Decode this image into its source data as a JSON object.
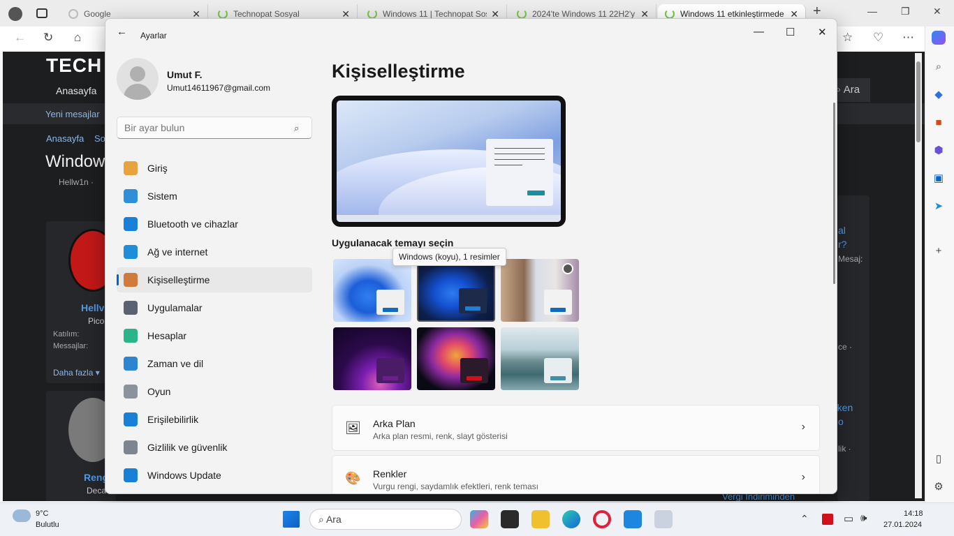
{
  "browser": {
    "tabs": [
      {
        "title": "Google"
      },
      {
        "title": "Technopat Sosyal"
      },
      {
        "title": "Windows 11 | Technopat Sos"
      },
      {
        "title": "2024'te Windows 11 22H2'y"
      },
      {
        "title": "Windows 11 etkinleştirmede",
        "active": true
      }
    ],
    "page": {
      "logo": "TECH",
      "menu_home": "Anasayfa",
      "search": "Ara",
      "new_messages": "Yeni mesajlar",
      "breadcrumb_home": "Anasayfa",
      "breadcrumb_2": "So",
      "thread_title": "Window",
      "author_line": "Hellw1n ·",
      "user1_name": "Hellv",
      "user1_role": "Pico",
      "join_label": "Katılım:",
      "messages_label": "Messajlar:",
      "more": "Daha fazla",
      "user2_name": "Reng",
      "user2_role": "Deca",
      "side_text1": "al",
      "side_text2": "r?",
      "side_text3": "Mesaj:",
      "side_text4": "ce ·",
      "side_text5": "rken",
      "side_text6": "o",
      "side_text7": "lik ·",
      "side_text8": "Vergi İndiriminden"
    }
  },
  "settings": {
    "app_title": "Ayarlar",
    "user_name": "Umut F.",
    "user_email": "Umut14611967@gmail.com",
    "search_placeholder": "Bir ayar bulun",
    "nav": [
      {
        "label": "Giriş",
        "icon": "home-icon",
        "color": "#e8a33d"
      },
      {
        "label": "Sistem",
        "icon": "system-icon",
        "color": "#2f8fd8"
      },
      {
        "label": "Bluetooth ve cihazlar",
        "icon": "bluetooth-icon",
        "color": "#1a7fd6"
      },
      {
        "label": "Ağ ve internet",
        "icon": "wifi-icon",
        "color": "#1f8ed9"
      },
      {
        "label": "Kişiselleştirme",
        "icon": "brush-icon",
        "color": "#d27a3c",
        "selected": true
      },
      {
        "label": "Uygulamalar",
        "icon": "apps-icon",
        "color": "#5a6170"
      },
      {
        "label": "Hesaplar",
        "icon": "account-icon",
        "color": "#2bb38a"
      },
      {
        "label": "Zaman ve dil",
        "icon": "clock-globe-icon",
        "color": "#2d84d1"
      },
      {
        "label": "Oyun",
        "icon": "gamepad-icon",
        "color": "#8a929c"
      },
      {
        "label": "Erişilebilirlik",
        "icon": "accessibility-icon",
        "color": "#1a7fd6"
      },
      {
        "label": "Gizlilik ve güvenlik",
        "icon": "shield-icon",
        "color": "#7d8590"
      },
      {
        "label": "Windows Update",
        "icon": "update-icon",
        "color": "#1a7fd6"
      }
    ],
    "page_title": "Kişiselleştirme",
    "themes_label": "Uygulanacak temayı seçin",
    "tooltip": "Windows (koyu), 1 resimler",
    "themes": [
      {
        "name": "windows-light",
        "accent": "#0f6cbd"
      },
      {
        "name": "windows-dark",
        "accent": "#1f7fd6"
      },
      {
        "name": "flower",
        "accent": "#0f6cbd"
      },
      {
        "name": "glow",
        "accent": "#6b1f8a"
      },
      {
        "name": "captured-motion",
        "accent": "#d0101a"
      },
      {
        "name": "sunrise",
        "accent": "#3f8fa8"
      }
    ],
    "cards": [
      {
        "title": "Arka Plan",
        "subtitle": "Arka plan resmi, renk, slayt gösterisi",
        "icon": "image-icon"
      },
      {
        "title": "Renkler",
        "subtitle": "Vurgu rengi, saydamlık efektleri, renk teması",
        "icon": "palette-icon"
      }
    ]
  },
  "taskbar": {
    "weather_temp": "9°C",
    "weather_text": "Bulutlu",
    "search_label": "Ara",
    "time": "14:18",
    "date": "27.01.2024"
  }
}
